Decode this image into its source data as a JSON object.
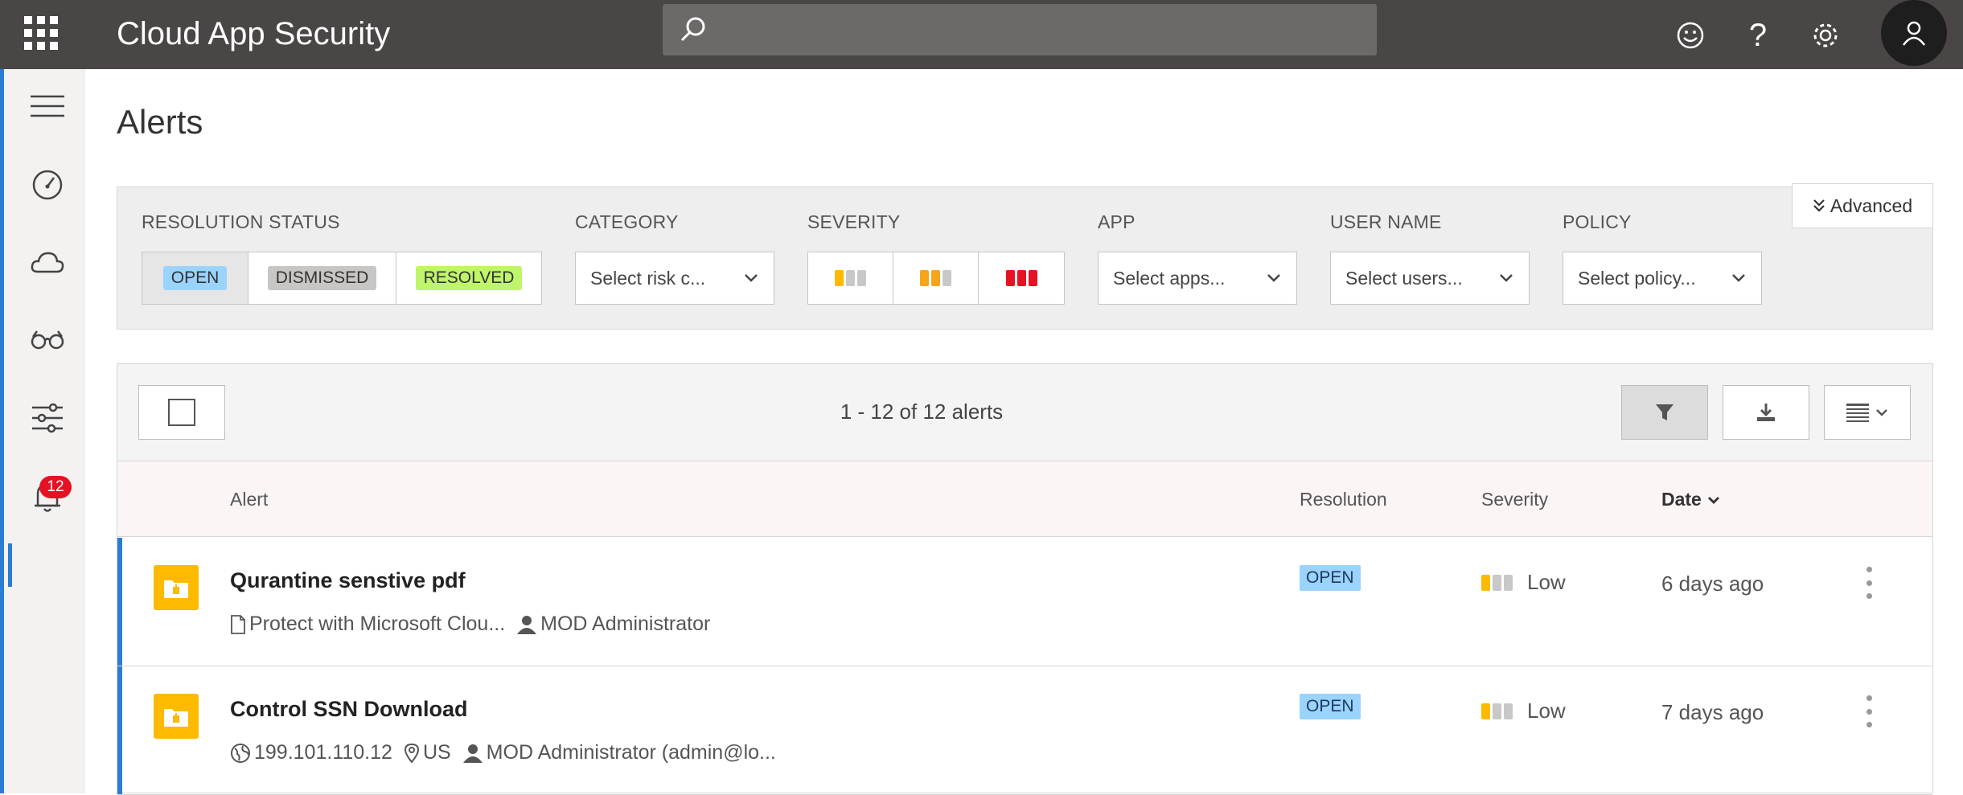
{
  "app": {
    "title": "Cloud App Security",
    "search_placeholder": ""
  },
  "nav": {
    "alerts_badge": "12"
  },
  "page": {
    "title": "Alerts"
  },
  "filters": {
    "resolution_status": {
      "label": "RESOLUTION STATUS",
      "options": [
        "OPEN",
        "DISMISSED",
        "RESOLVED"
      ],
      "selected": "OPEN"
    },
    "category": {
      "label": "CATEGORY",
      "value": "Select risk c..."
    },
    "severity": {
      "label": "SEVERITY",
      "levels": [
        "low",
        "medium",
        "high"
      ]
    },
    "app": {
      "label": "APP",
      "value": "Select apps..."
    },
    "user_name": {
      "label": "USER NAME",
      "value": "Select users..."
    },
    "policy": {
      "label": "POLICY",
      "value": "Select policy..."
    },
    "advanced_label": "Advanced"
  },
  "colors": {
    "accent": "#2b7cd3",
    "topbar": "#4b4646",
    "alert_icon": "#ffb900",
    "open": "#9bd3ff",
    "dismissed": "#c8c6c4",
    "resolved": "#bff56a",
    "sev_low": "#ffb900",
    "sev_medium": "#f7a41d",
    "sev_high": "#e81123",
    "sev_off": "#c8c8c8"
  },
  "table": {
    "count_text": "1 - 12 of 12 alerts",
    "columns": {
      "alert": "Alert",
      "resolution": "Resolution",
      "severity": "Severity",
      "date": "Date"
    },
    "rows": [
      {
        "title": "Qurantine senstive pdf",
        "meta": [
          {
            "icon": "document-icon",
            "text": "Protect with Microsoft Clou..."
          },
          {
            "icon": "user-icon",
            "text": "MOD Administrator"
          }
        ],
        "resolution": "OPEN",
        "severity": "Low",
        "date": "6 days ago"
      },
      {
        "title": "Control SSN Download",
        "meta": [
          {
            "icon": "globe-icon",
            "text": "199.101.110.12"
          },
          {
            "icon": "location-pin-icon",
            "text": "US"
          },
          {
            "icon": "user-icon",
            "text": "MOD Administrator (admin@lo..."
          }
        ],
        "resolution": "OPEN",
        "severity": "Low",
        "date": "7 days ago"
      }
    ]
  }
}
